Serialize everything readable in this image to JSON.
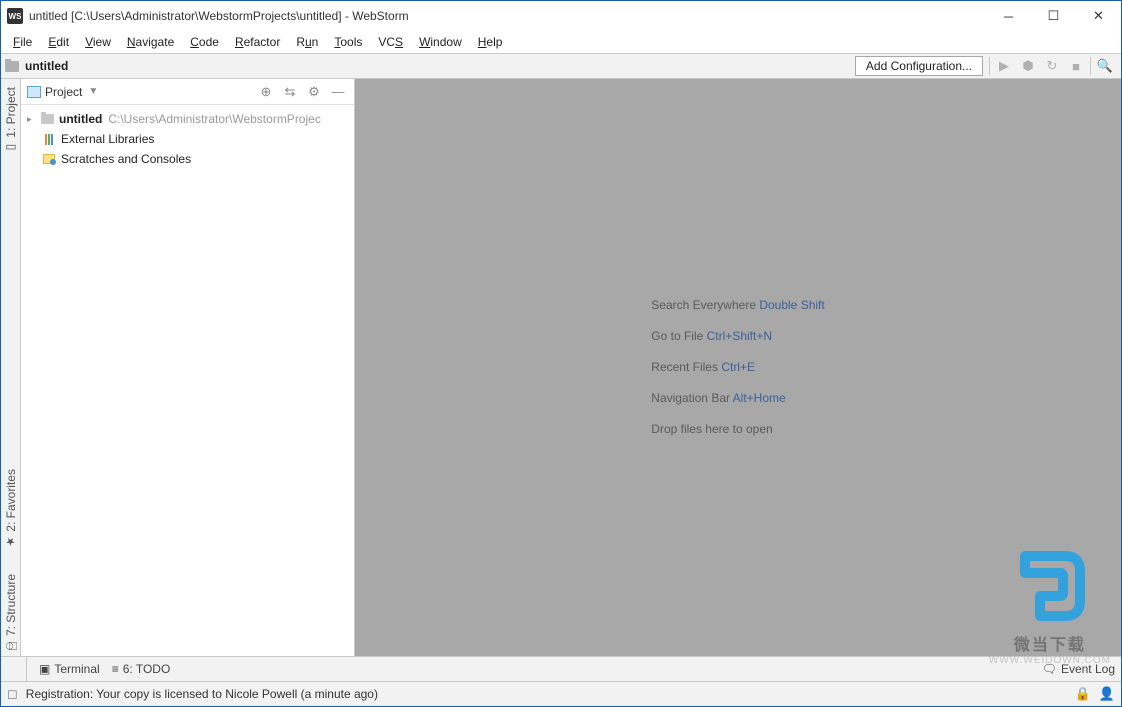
{
  "window": {
    "title": "untitled [C:\\Users\\Administrator\\WebstormProjects\\untitled] - WebStorm",
    "app_icon_text": "WS"
  },
  "menu": {
    "items": [
      {
        "letter": "F",
        "rest": "ile"
      },
      {
        "letter": "E",
        "rest": "dit"
      },
      {
        "letter": "V",
        "rest": "iew"
      },
      {
        "letter": "N",
        "rest": "avigate"
      },
      {
        "letter": "C",
        "rest": "ode"
      },
      {
        "letter": "R",
        "rest": "efactor"
      },
      {
        "letter": "R",
        "rest": "un",
        "pre": ""
      },
      {
        "letter": "T",
        "rest": "ools"
      },
      {
        "letter": "",
        "rest": "VC",
        "post_letter": "S"
      },
      {
        "letter": "W",
        "rest": "indow"
      },
      {
        "letter": "H",
        "rest": "elp"
      }
    ]
  },
  "breadcrumb": {
    "project": "untitled"
  },
  "toolbar": {
    "add_config": "Add Configuration..."
  },
  "left_tabs": {
    "project": "1: Project",
    "favorites": "2: Favorites",
    "structure": "7: Structure"
  },
  "project_panel": {
    "title": "Project",
    "root": {
      "name": "untitled",
      "path": "C:\\Users\\Administrator\\WebstormProjec"
    },
    "external_libs": "External Libraries",
    "scratches": "Scratches and Consoles"
  },
  "editor_tips": {
    "search": {
      "label": "Search Everywhere ",
      "shortcut": "Double Shift"
    },
    "goto": {
      "label": "Go to File ",
      "shortcut": "Ctrl+Shift+N"
    },
    "recent": {
      "label": "Recent Files ",
      "shortcut": "Ctrl+E"
    },
    "navbar": {
      "label": "Navigation Bar ",
      "shortcut": "Alt+Home"
    },
    "drop": "Drop files here to open"
  },
  "bottom_tabs": {
    "terminal": "Terminal",
    "todo": "6: TODO",
    "event_log": "Event Log"
  },
  "status": {
    "message": "Registration: Your copy is licensed to Nicole Powell (a minute ago)"
  },
  "watermark": {
    "text": "微当下载",
    "url": "WWW.WEIDOWN.COM"
  }
}
